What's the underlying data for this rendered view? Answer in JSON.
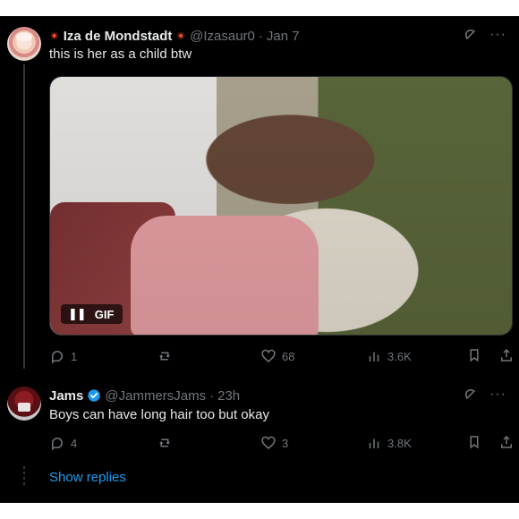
{
  "tweet1": {
    "author_name": "Iza de Mondstadt",
    "author_handle": "@Izasaur0",
    "separator": "·",
    "time": "Jan 7",
    "text": "this is her as a child btw",
    "media_badge": "GIF",
    "actions": {
      "reply_count": "1",
      "retweet_count": "",
      "like_count": "68",
      "views_count": "3.6K"
    }
  },
  "tweet2": {
    "author_name": "Jams",
    "author_handle": "@JammersJams",
    "separator": "·",
    "time": "23h",
    "text": "Boys can have long hair too but okay",
    "actions": {
      "reply_count": "4",
      "retweet_count": "",
      "like_count": "3",
      "views_count": "3.8K"
    }
  },
  "show_replies_label": "Show replies",
  "icons": {
    "reply": "reply-icon",
    "retweet": "retweet-icon",
    "like": "like-icon",
    "views": "views-icon",
    "bookmark": "bookmark-icon",
    "share": "share-icon",
    "grok": "grok-icon",
    "more": "more-icon",
    "verified": "verified-badge-icon",
    "pause": "pause-icon"
  },
  "colors": {
    "background": "#000000",
    "text_primary": "#e7e9ea",
    "text_secondary": "#71767b",
    "accent_blue": "#1d9bf0",
    "emoji_star": "#ff4d2e"
  }
}
